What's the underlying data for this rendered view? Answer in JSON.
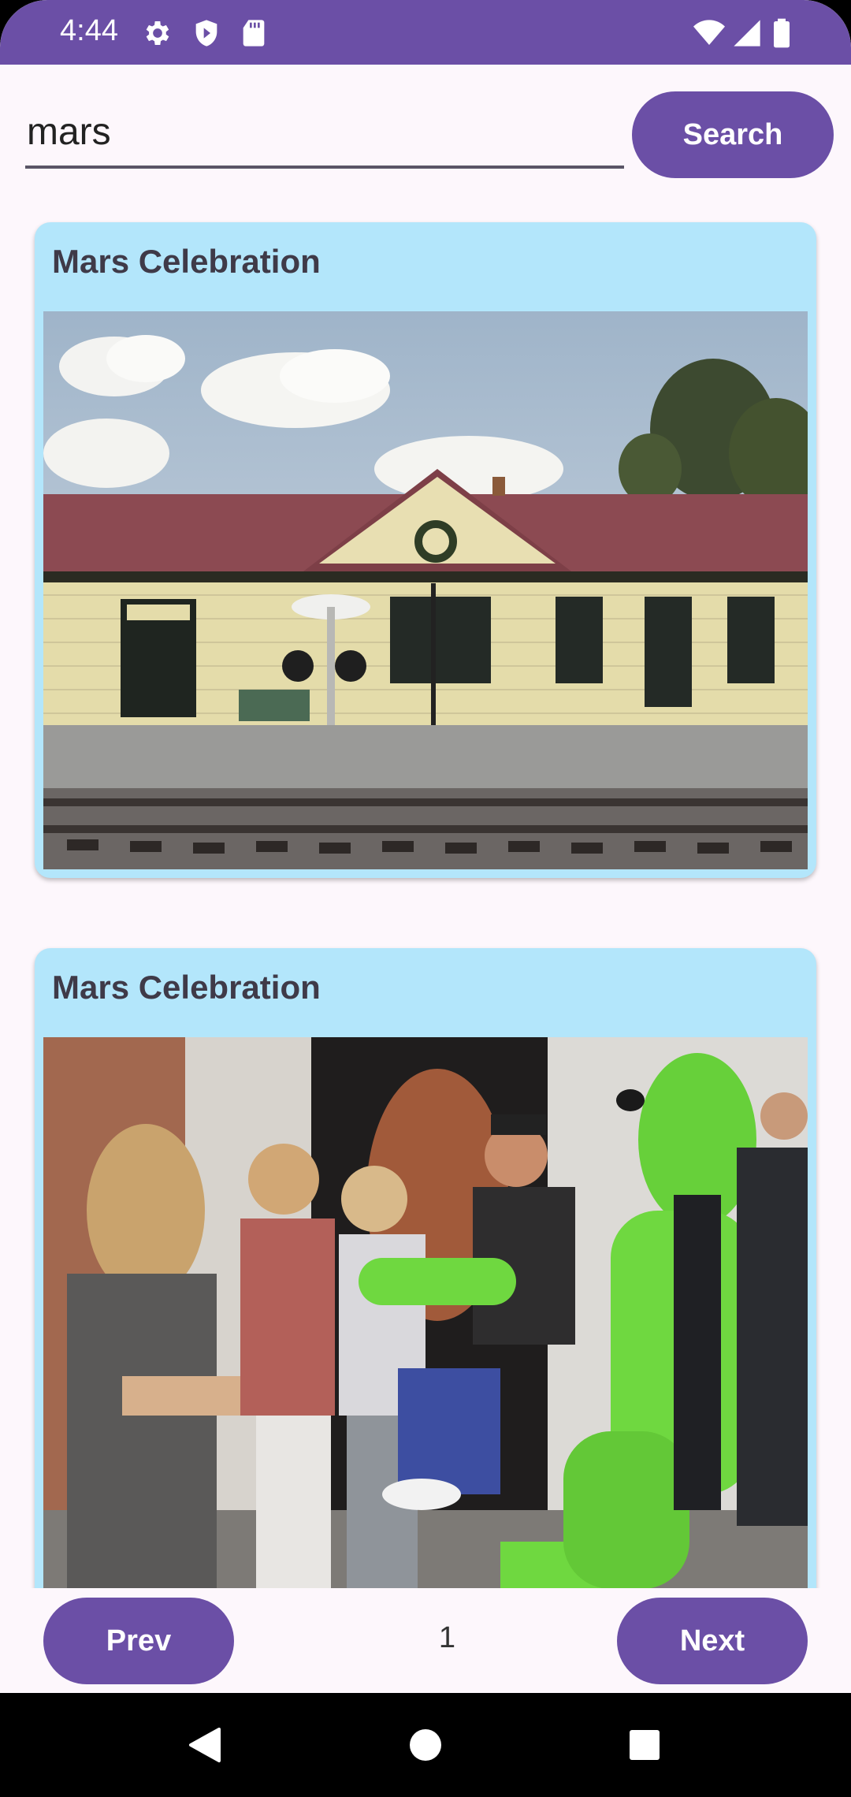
{
  "status_bar": {
    "time": "4:44",
    "icons_left": [
      "gear-icon",
      "shield-icon",
      "sd-card-icon"
    ],
    "icons_right": [
      "wifi-icon",
      "signal-icon",
      "battery-icon"
    ]
  },
  "search": {
    "query": "mars",
    "button_label": "Search"
  },
  "results": [
    {
      "title": "Mars Celebration",
      "image": "train-station-photo"
    },
    {
      "title": "Mars Celebration",
      "image": "alien-costume-crowd-photo"
    }
  ],
  "paging": {
    "prev_label": "Prev",
    "page": "1",
    "next_label": "Next"
  },
  "nav_bar": {
    "icons": [
      "back-icon",
      "home-icon",
      "recents-icon"
    ]
  },
  "colors": {
    "primary": "#6b4fa6",
    "card_background": "#b3e6fb",
    "screen_background": "#fdf7fc"
  }
}
